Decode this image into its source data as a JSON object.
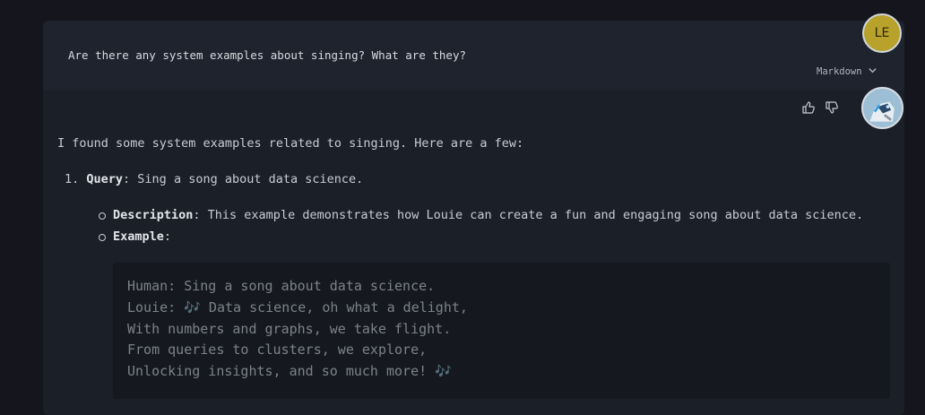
{
  "user_message": {
    "text": "Are there any system examples about singing? What are they?",
    "avatar_initials": "LE",
    "format_label": "Markdown"
  },
  "assistant": {
    "intro": "I found some system examples related to singing. Here are a few:",
    "list": [
      {
        "number": "1.",
        "title": "Query",
        "title_rest": ": Sing a song about data science.",
        "sub_items": [
          {
            "label": "Description",
            "text": ": This example demonstrates how Louie can create a fun and engaging song about data science."
          },
          {
            "label": "Example",
            "text": ":"
          }
        ]
      }
    ],
    "code_lines": [
      "Human: Sing a song about data science.",
      "Louie: 🎶 Data science, oh what a delight,",
      "With numbers and graphs, we take flight.",
      "From queries to clusters, we explore,",
      "Unlocking insights, and so much more! 🎶"
    ]
  },
  "icons": {
    "thumbs_up": "thumbs-up-icon",
    "thumbs_down": "thumbs-down-icon",
    "chevron": "chevron-down-icon"
  },
  "colors": {
    "background": "#15151d",
    "panel": "#1b1f28",
    "user_avatar": "#b8a22b",
    "code_bg": "#16181f"
  }
}
